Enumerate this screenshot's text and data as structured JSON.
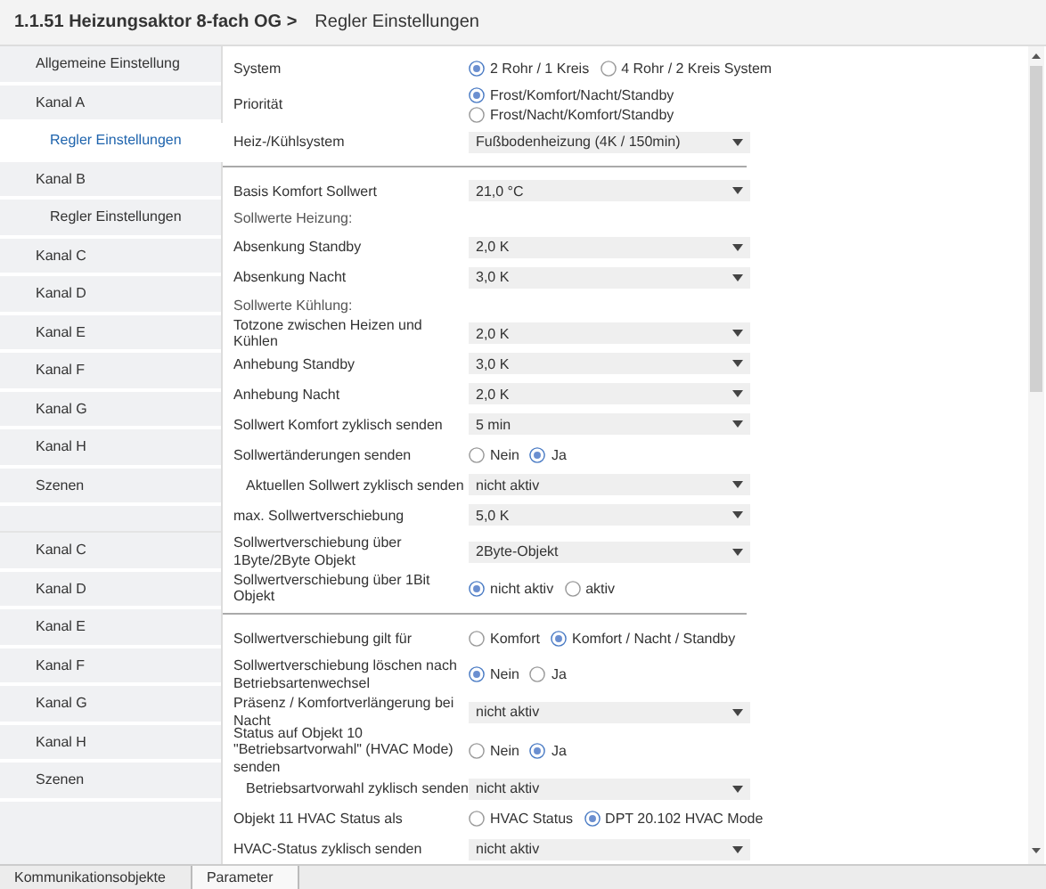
{
  "breadcrumb": [
    {
      "label": "1.1.51 Heizungsaktor 8-fach OG >"
    },
    {
      "label": "Regler Einstellungen"
    }
  ],
  "sidebar": {
    "groups": [
      {
        "items": [
          {
            "label": "Allgemeine Einstellung",
            "selected": false,
            "indented": false
          },
          {
            "label": "Kanal A",
            "selected": false,
            "indented": false
          },
          {
            "label": "Regler Einstellungen",
            "selected": true,
            "indented": true
          },
          {
            "label": "Kanal B",
            "selected": false,
            "indented": false
          },
          {
            "label": "Regler Einstellungen",
            "selected": false,
            "indented": true
          },
          {
            "label": "Kanal C",
            "selected": false,
            "indented": false
          },
          {
            "label": "Kanal D",
            "selected": false,
            "indented": false
          },
          {
            "label": "Kanal E",
            "selected": false,
            "indented": false
          },
          {
            "label": "Kanal F",
            "selected": false,
            "indented": false
          },
          {
            "label": "Kanal G",
            "selected": false,
            "indented": false
          },
          {
            "label": "Kanal H",
            "selected": false,
            "indented": false
          },
          {
            "label": "Szenen",
            "selected": false,
            "indented": false
          }
        ]
      },
      {
        "items": [
          {
            "label": "Kanal C",
            "selected": false,
            "indented": false
          },
          {
            "label": "Kanal D",
            "selected": false,
            "indented": false
          },
          {
            "label": "Kanal E",
            "selected": false,
            "indented": false
          },
          {
            "label": "Kanal F",
            "selected": false,
            "indented": false
          },
          {
            "label": "Kanal G",
            "selected": false,
            "indented": false
          },
          {
            "label": "Kanal H",
            "selected": false,
            "indented": false
          },
          {
            "label": "Szenen",
            "selected": false,
            "indented": false
          }
        ]
      }
    ]
  },
  "parameters": [
    {
      "kind": "radio",
      "label": "System",
      "indented": false,
      "options": [
        {
          "label": "2 Rohr / 1 Kreis",
          "selected": true
        },
        {
          "label": "4 Rohr / 2 Kreis System",
          "selected": false
        }
      ]
    },
    {
      "kind": "radio-list",
      "label": "Priorität",
      "indented": false,
      "options": [
        {
          "label": "Frost/Komfort/Nacht/Standby",
          "selected": true
        },
        {
          "label": "Frost/Nacht/Komfort/Standby",
          "selected": false
        }
      ]
    },
    {
      "kind": "dropdown",
      "label": "Heiz-/Kühlsystem",
      "indented": false,
      "value": "Fußbodenheizung (4K / 150min)"
    },
    {
      "kind": "divider"
    },
    {
      "kind": "dropdown",
      "label": "Basis Komfort Sollwert",
      "indented": false,
      "value": "21,0 °C"
    },
    {
      "kind": "heading",
      "label": "Sollwerte Heizung:"
    },
    {
      "kind": "dropdown",
      "label": "Absenkung Standby",
      "indented": false,
      "value": "2,0 K"
    },
    {
      "kind": "dropdown",
      "label": "Absenkung Nacht",
      "indented": false,
      "value": "3,0 K"
    },
    {
      "kind": "heading",
      "label": "Sollwerte Kühlung:"
    },
    {
      "kind": "dropdown",
      "label": "Totzone zwischen Heizen und Kühlen",
      "indented": false,
      "value": "2,0 K"
    },
    {
      "kind": "dropdown",
      "label": "Anhebung Standby",
      "indented": false,
      "value": "3,0 K"
    },
    {
      "kind": "dropdown",
      "label": "Anhebung Nacht",
      "indented": false,
      "value": "2,0 K"
    },
    {
      "kind": "dropdown",
      "label": "Sollwert Komfort zyklisch senden",
      "indented": false,
      "value": "5 min"
    },
    {
      "kind": "radio",
      "label": "Sollwertänderungen senden",
      "indented": false,
      "options": [
        {
          "label": "Nein",
          "selected": false
        },
        {
          "label": "Ja",
          "selected": true
        }
      ]
    },
    {
      "kind": "dropdown",
      "label": "Aktuellen Sollwert zyklisch senden",
      "indented": true,
      "value": "nicht aktiv"
    },
    {
      "kind": "dropdown",
      "label": "max. Sollwertverschiebung",
      "indented": false,
      "value": "5,0 K"
    },
    {
      "kind": "dropdown",
      "label": "Sollwertverschiebung über 1Byte/2Byte Objekt",
      "indented": false,
      "value": "2Byte-Objekt"
    },
    {
      "kind": "radio",
      "label": "Sollwertverschiebung über 1Bit Objekt",
      "indented": false,
      "options": [
        {
          "label": "nicht aktiv",
          "selected": true
        },
        {
          "label": "aktiv",
          "selected": false
        }
      ]
    },
    {
      "kind": "divider"
    },
    {
      "kind": "radio",
      "label": "Sollwertverschiebung gilt für",
      "indented": false,
      "options": [
        {
          "label": "Komfort",
          "selected": false
        },
        {
          "label": "Komfort / Nacht / Standby",
          "selected": true
        }
      ]
    },
    {
      "kind": "radio",
      "label": "Sollwertverschiebung löschen nach Betriebsartenwechsel",
      "indented": false,
      "options": [
        {
          "label": "Nein",
          "selected": true
        },
        {
          "label": "Ja",
          "selected": false
        }
      ]
    },
    {
      "kind": "dropdown",
      "label": "Präsenz / Komfortverlängerung bei Nacht",
      "indented": false,
      "value": "nicht aktiv"
    },
    {
      "kind": "radio",
      "label": "Status auf Objekt 10 \"Betriebsartvorwahl\" (HVAC Mode) senden",
      "indented": false,
      "options": [
        {
          "label": "Nein",
          "selected": false
        },
        {
          "label": "Ja",
          "selected": true
        }
      ]
    },
    {
      "kind": "dropdown",
      "label": "Betriebsartvorwahl zyklisch senden",
      "indented": true,
      "value": "nicht aktiv"
    },
    {
      "kind": "radio",
      "label": "Objekt 11 HVAC Status als",
      "indented": false,
      "options": [
        {
          "label": "HVAC Status",
          "selected": false
        },
        {
          "label": "DPT 20.102 HVAC Mode",
          "selected": true
        }
      ]
    },
    {
      "kind": "dropdown",
      "label": "HVAC-Status zyklisch senden",
      "indented": false,
      "value": "nicht aktiv"
    }
  ],
  "bottom_tabs": [
    {
      "label": "Kommunikationsobjekte",
      "selected": false
    },
    {
      "label": "Parameter",
      "selected": true
    }
  ]
}
